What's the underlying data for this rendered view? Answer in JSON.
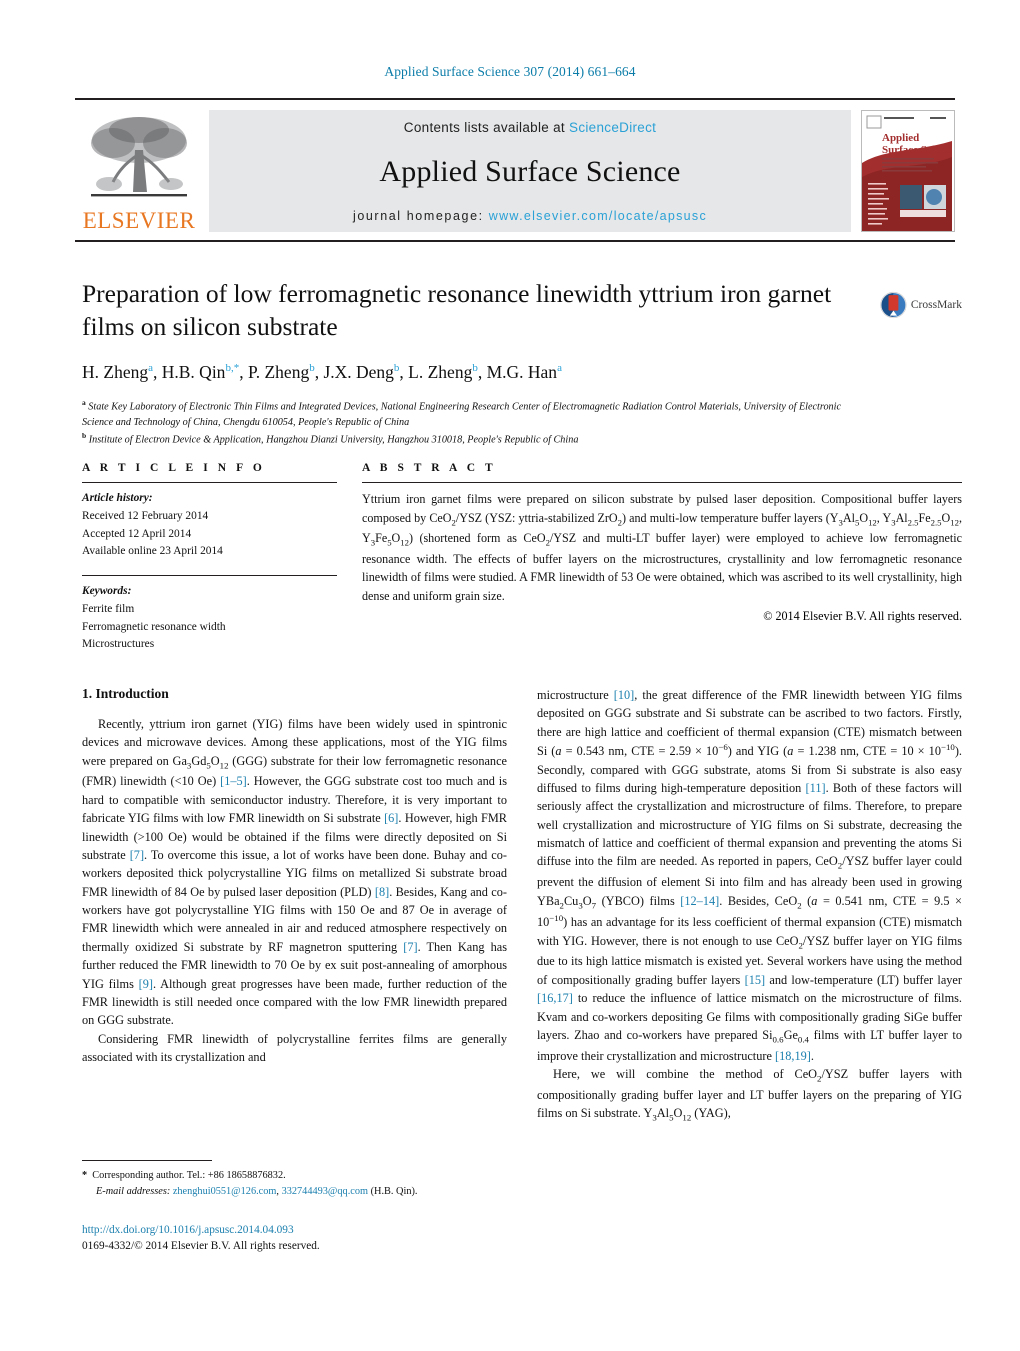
{
  "running_head": "Applied Surface Science 307 (2014) 661–664",
  "masthead": {
    "publisher_wordmark": "ELSEVIER",
    "contents_prefix": "Contents lists available at ",
    "contents_link": "ScienceDirect",
    "journal_name": "Applied Surface Science",
    "homepage_prefix": "journal homepage: ",
    "homepage_url": "www.elsevier.com/locate/apsusc",
    "cover": {
      "title_line1": "Applied",
      "title_line2": "Surface Science"
    }
  },
  "article": {
    "title": "Preparation of low ferromagnetic resonance linewidth yttrium iron garnet films on silicon substrate",
    "crossmark_label": "CrossMark",
    "authors_html": "H. Zheng<sup>a</sup>, H.B. Qin<sup>b,*</sup>, P. Zheng<sup>b</sup>, J.X. Deng<sup>b</sup>, L. Zheng<sup>b</sup>, M.G. Han<sup>a</sup>",
    "affiliations": [
      "State Key Laboratory of Electronic Thin Films and Integrated Devices, National Engineering Research Center of Electromagnetic Radiation Control Materials, University of Electronic Science and Technology of China, Chengdu 610054, People's Republic of China",
      "Institute of Electron Device & Application, Hangzhou Dianzi University, Hangzhou 310018, People's Republic of China"
    ]
  },
  "article_info": {
    "heading": "A R T I C L E   I N F O",
    "history_label": "Article history:",
    "history": [
      "Received 12 February 2014",
      "Accepted 12 April 2014",
      "Available online 23 April 2014"
    ],
    "keywords_label": "Keywords:",
    "keywords": [
      "Ferrite film",
      "Ferromagnetic resonance width",
      "Microstructures"
    ]
  },
  "abstract": {
    "heading": "A B S T R A C T",
    "text_html": "Yttrium iron garnet films were prepared on silicon substrate by pulsed laser deposition. Compositional buffer layers composed by CeO<sub>2</sub>/YSZ (YSZ: yttria-stabilized ZrO<sub>2</sub>) and multi-low temperature buffer layers (Y<sub>3</sub>Al<sub>5</sub>O<sub>12</sub>, Y<sub>3</sub>Al<sub>2.5</sub>Fe<sub>2.5</sub>O<sub>12</sub>, Y<sub>3</sub>Fe<sub>5</sub>O<sub>12</sub>) (shortened form as CeO<sub>2</sub>/YSZ and multi-LT buffer layer) were employed to achieve low ferromagnetic resonance width. The effects of buffer layers on the microstructures, crystallinity and low ferromagnetic resonance linewidth of films were studied. A FMR linewidth of 53 Oe were obtained, which was ascribed to its well crystallinity, high dense and uniform grain size.",
    "copyright": "© 2014 Elsevier B.V. All rights reserved."
  },
  "sections": {
    "intro_heading": "1.  Introduction",
    "left_paragraphs_html": [
      "Recently, yttrium iron garnet (YIG) films have been widely used in spintronic devices and microwave devices. Among these applications, most of the YIG films were prepared on Ga<sub>3</sub>Gd<sub>5</sub>O<sub>12</sub> (GGG) substrate for their low ferromagnetic resonance (FMR) linewidth (&lt;10 Oe) <span class=\"ref\">[1–5]</span>. However, the GGG substrate cost too much and is hard to compatible with semiconductor industry. Therefore, it is very important to fabricate YIG films with low FMR linewidth on Si substrate <span class=\"ref\">[6]</span>. However, high FMR linewidth (&gt;100 Oe) would be obtained if the films were directly deposited on Si substrate <span class=\"ref\">[7]</span>. To overcome this issue, a lot of works have been done. Buhay and co-workers deposited thick polycrystalline YIG films on metallized Si substrate broad FMR linewidth of 84 Oe by pulsed laser deposition (PLD) <span class=\"ref\">[8]</span>. Besides, Kang and co-workers have got polycrystalline YIG films with 150 Oe and 87 Oe in average of FMR linewidth which were annealed in air and reduced atmosphere respectively on thermally oxidized Si substrate by RF magnetron sputtering <span class=\"ref\">[7]</span>. Then Kang has further reduced the FMR linewidth to 70 Oe by ex suit post-annealing of amorphous YIG films <span class=\"ref\">[9]</span>. Although great progresses have been made, further reduction of the FMR linewidth is still needed once compared with the low FMR linewidth prepared on GGG substrate.",
      "Considering FMR linewidth of polycrystalline ferrites films are generally associated with its crystallization and"
    ],
    "right_paragraphs_html": [
      "microstructure <span class=\"ref\">[10]</span>, the great difference of the FMR linewidth between YIG films deposited on GGG substrate and Si substrate can be ascribed to two factors. Firstly, there are high lattice and coefficient of thermal expansion (CTE) mismatch between Si (<i>a</i> = 0.543 nm, CTE = 2.59 × 10<sup>−6</sup>) and YIG (<i>a</i> = 1.238 nm, CTE = 10 × 10<sup>−10</sup>). Secondly, compared with GGG substrate, atoms Si from Si substrate is also easy diffused to films during high-temperature deposition <span class=\"ref\">[11]</span>. Both of these factors will seriously affect the crystallization and microstructure of films. Therefore, to prepare well crystallization and microstructure of YIG films on Si substrate, decreasing the mismatch of lattice and coefficient of thermal expansion and preventing the atoms Si diffuse into the film are needed. As reported in papers, CeO<sub>2</sub>/YSZ buffer layer could prevent the diffusion of element Si into film and has already been used in growing YBa<sub>2</sub>Cu<sub>3</sub>O<sub>7</sub> (YBCO) films <span class=\"ref\">[12–14]</span>. Besides, CeO<sub>2</sub> (<i>a</i> = 0.541 nm, CTE = 9.5 × 10<sup>−10</sup>) has an advantage for its less coefficient of thermal expansion (CTE) mismatch with YIG. However, there is not enough to use CeO<sub>2</sub>/YSZ buffer layer on YIG films due to its high lattice mismatch is existed yet. Several workers have using the method of compositionally grading buffer layers <span class=\"ref\">[15]</span> and low-temperature (LT) buffer layer <span class=\"ref\">[16,17]</span> to reduce the influence of lattice mismatch on the microstructure of films. Kvam and co-workers depositing Ge films with compositionally grading SiGe buffer layers. Zhao and co-workers have prepared Si<sub>0.6</sub>Ge<sub>0.4</sub> films with LT buffer layer to improve their crystallization and microstructure <span class=\"ref\">[18,19]</span>.",
      "Here, we will combine the method of CeO<sub>2</sub>/YSZ buffer layers with compositionally grading buffer layer and LT buffer layers on the preparing of YIG films on Si substrate. Y<sub>3</sub>Al<sub>5</sub>O<sub>12</sub> (YAG),"
    ]
  },
  "footnote": {
    "corresponding_html": "<b>*</b> &nbsp;Corresponding author. Tel.: +86 18658876832.",
    "email_label": "E-mail addresses:",
    "email_1": "zhenghui0551@126.com",
    "email_2": "332744493@qq.com",
    "email_owner": "(H.B. Qin)."
  },
  "bottom": {
    "doi": "http://dx.doi.org/10.1016/j.apsusc.2014.04.093",
    "issn_line": "0169-4332/© 2014 Elsevier B.V. All rights reserved."
  },
  "colors": {
    "link_blue": "#1b7fae",
    "sciencedirect_blue": "#2aa1d6",
    "elsevier_orange": "#E87722",
    "band_gray": "#e6e7e8",
    "cover_red": "#a32e2e"
  }
}
